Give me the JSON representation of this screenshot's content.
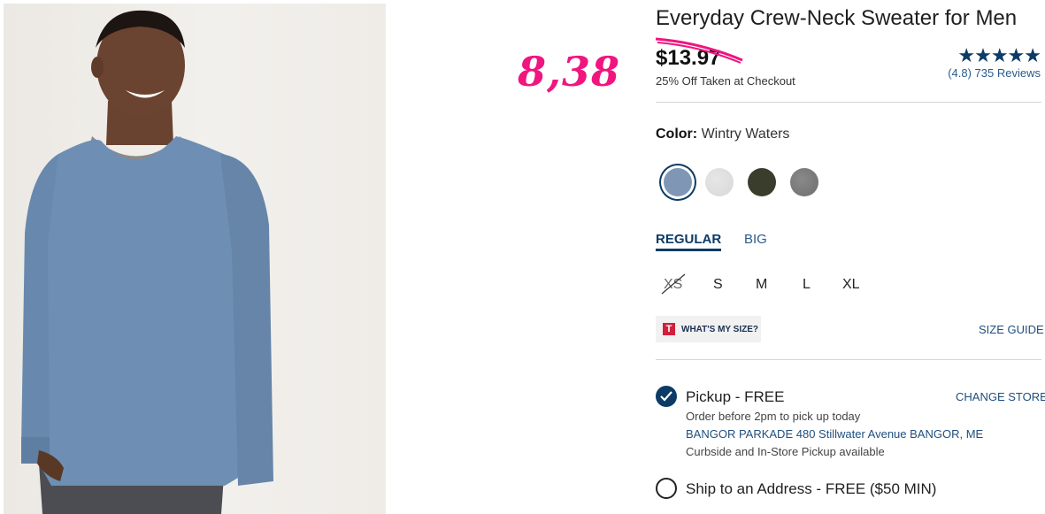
{
  "annotation": {
    "handwritten_price": "8,38"
  },
  "product": {
    "title": "Everyday Crew-Neck Sweater for Men",
    "price": "$13.97",
    "discount_note": "25% Off Taken at Checkout",
    "rating": {
      "stars": "★★★★★",
      "reviews": "(4.8) 735 Reviews"
    }
  },
  "color": {
    "label": "Color:",
    "selected": "Wintry Waters",
    "swatches": [
      {
        "name": "Wintry Waters",
        "hex": "#7f97b5",
        "selected": true
      },
      {
        "name": "Light Heather Gray",
        "hex": "#d8d8d8",
        "selected": false
      },
      {
        "name": "Olive",
        "hex": "#3b3d2c",
        "selected": false
      },
      {
        "name": "Charcoal Heather",
        "hex": "#6d6d6d",
        "selected": false
      }
    ]
  },
  "fit_tabs": [
    {
      "label": "REGULAR",
      "active": true
    },
    {
      "label": "BIG",
      "active": false
    }
  ],
  "sizes": [
    {
      "label": "XS",
      "available": false
    },
    {
      "label": "S",
      "available": true
    },
    {
      "label": "M",
      "available": true
    },
    {
      "label": "L",
      "available": true
    },
    {
      "label": "XL",
      "available": true
    }
  ],
  "size_help": {
    "logo": "T",
    "whats_my_size": "WHAT'S MY SIZE?",
    "size_guide": "SIZE GUIDE"
  },
  "fulfillment": {
    "pickup": {
      "title": "Pickup - FREE",
      "change_store": "CHANGE STORE",
      "cutoff": "Order before 2pm to pick up today",
      "store": "BANGOR PARKADE 480 Stillwater Avenue  BANGOR, ME",
      "note": "Curbside and In-Store Pickup available",
      "checked": true
    },
    "ship": {
      "title": "Ship to an Address - FREE ($50 MIN)",
      "checked": false
    }
  },
  "colors": {
    "accent": "#0b3b66",
    "link": "#1f4f7f",
    "annotation": "#f0157f"
  }
}
